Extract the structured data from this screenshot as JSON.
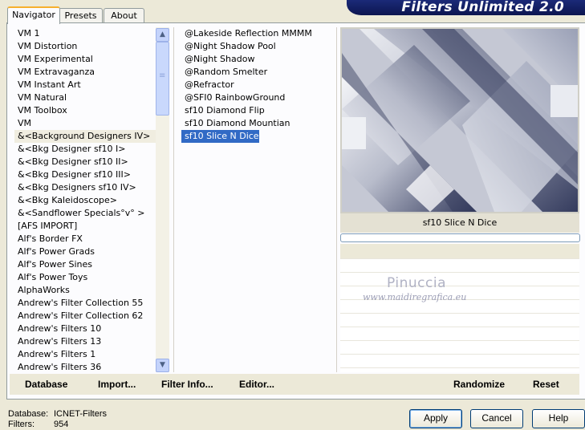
{
  "app": {
    "title": "Filters Unlimited 2.0"
  },
  "tabs": [
    {
      "label": "Navigator",
      "active": true
    },
    {
      "label": "Presets",
      "active": false
    },
    {
      "label": "About",
      "active": false
    }
  ],
  "categories": [
    "VM 1",
    "VM Distortion",
    "VM Experimental",
    "VM Extravaganza",
    "VM Instant Art",
    "VM Natural",
    "VM Toolbox",
    "VM",
    "&<Background Designers IV>",
    "&<Bkg Designer sf10 I>",
    "&<Bkg Designer sf10 II>",
    "&<Bkg Designer sf10 III>",
    "&<Bkg Designers sf10 IV>",
    "&<Bkg Kaleidoscope>",
    "&<Sandflower Specials°v° >",
    "[AFS IMPORT]",
    "Alf's Border FX",
    "Alf's Power Grads",
    "Alf's Power Sines",
    "Alf's Power Toys",
    "AlphaWorks",
    "Andrew's Filter Collection 55",
    "Andrew's Filter Collection 62",
    "Andrew's Filters 10",
    "Andrew's Filters 13",
    "Andrew's Filters 1",
    "Andrew's Filters 36"
  ],
  "selected_category": "&<Background Designers IV>",
  "filters": [
    "@Lakeside Reflection MMMM",
    "@Night Shadow Pool",
    "@Night Shadow",
    "@Random Smelter",
    "@Refractor",
    "@SFI0 RainbowGround",
    "sf10 Diamond Flip",
    "sf10 Diamond Mountian",
    "sf10 Slice N Dice"
  ],
  "selected_filter": "sf10 Slice N Dice",
  "preview": {
    "filter_name": "sf10 Slice N Dice"
  },
  "watermark": {
    "name": "Pinuccia",
    "url": "www.maidiregrafica.eu"
  },
  "actions": {
    "database": "Database",
    "import": "Import...",
    "filter_info": "Filter Info...",
    "editor": "Editor...",
    "randomize": "Randomize",
    "reset": "Reset"
  },
  "footer": {
    "database_label": "Database:",
    "database_value": "ICNET-Filters",
    "filters_label": "Filters:",
    "filters_value": "954"
  },
  "buttons": {
    "apply": "Apply",
    "cancel": "Cancel",
    "help": "Help"
  },
  "colors": {
    "selection": "#316ac5",
    "banner": "#0c1550",
    "tab_highlight": "#f6b02e"
  }
}
